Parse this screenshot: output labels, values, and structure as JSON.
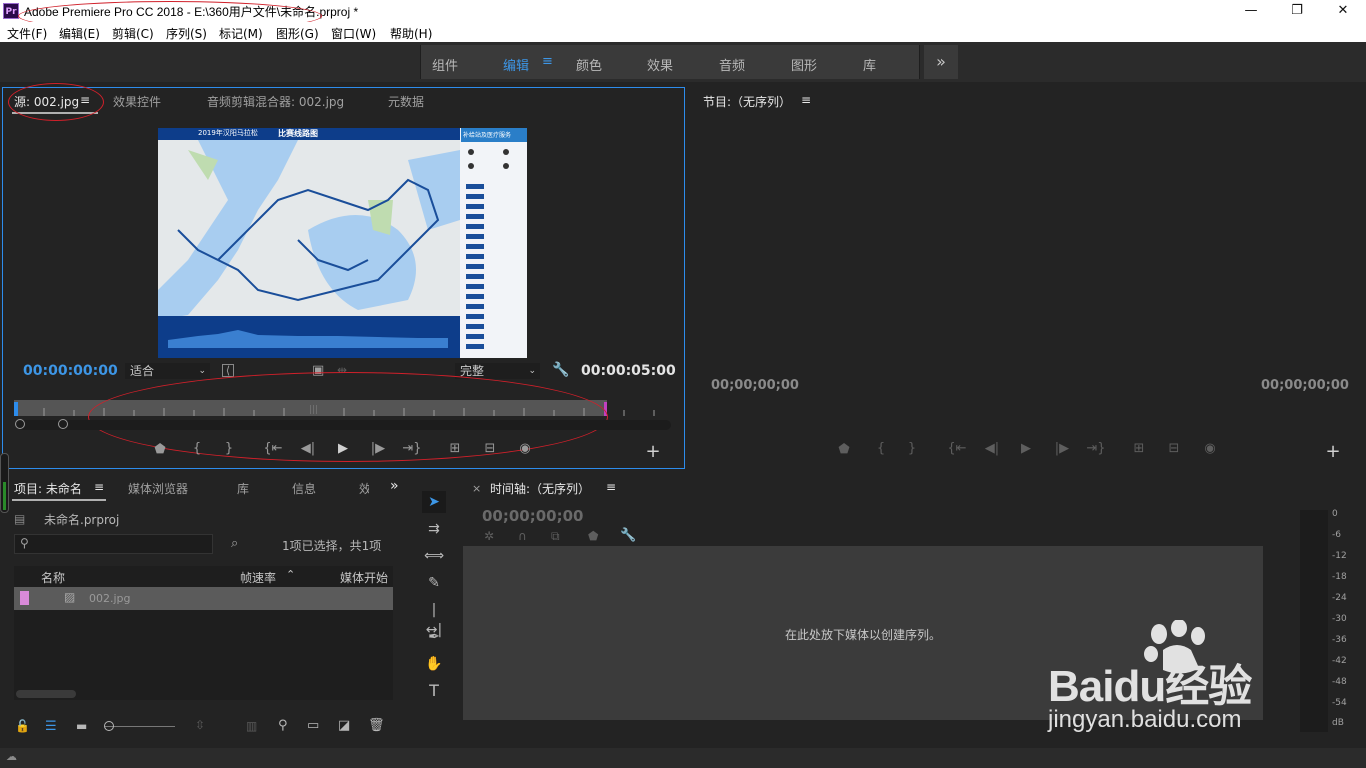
{
  "window": {
    "title": "Adobe Premiere Pro CC 2018 - E:\\360用户文件\\未命名.prproj *",
    "logo_text": "Pr",
    "controls": [
      "—",
      "❐",
      "✕"
    ]
  },
  "menu": [
    "文件(F)",
    "编辑(E)",
    "剪辑(C)",
    "序列(S)",
    "标记(M)",
    "图形(G)",
    "窗口(W)",
    "帮助(H)"
  ],
  "workspaces": {
    "items": [
      "组件",
      "编辑",
      "颜色",
      "效果",
      "音频",
      "图形",
      "库"
    ],
    "active": "编辑",
    "more": "»",
    "menu_icon": "≡"
  },
  "source_panel": {
    "tabs": [
      "源: 002.jpg",
      "效果控件",
      "音频剪辑混合器: 002.jpg",
      "元数据"
    ],
    "active_tab": "源: 002.jpg",
    "timecode_in": "00:00:00:00",
    "timecode_out": "00:00:05:00",
    "zoom_select": "适合",
    "quality_select": "完整",
    "preview": {
      "header_text": "比赛线路图",
      "header_small": "2019年汉阳马拉松",
      "side_header": "补给站及医疗服务"
    }
  },
  "program_panel": {
    "tab": "节目:（无序列）",
    "timecode_left": "00;00;00;00",
    "timecode_right": "00;00;00;00"
  },
  "project_panel": {
    "tabs": [
      "项目: 未命名",
      "媒体浏览器",
      "库",
      "信息",
      "效"
    ],
    "active_tab": "项目: 未命名",
    "project_file": "未命名.prproj",
    "selection_info": "1项已选择，共1项",
    "search_placeholder": "",
    "columns": [
      "名称",
      "帧速率",
      "媒体开始"
    ],
    "items": [
      {
        "name": "002.jpg",
        "label_color": "#d98ad9"
      }
    ]
  },
  "timeline_panel": {
    "tab": "时间轴:（无序列）",
    "timecode": "00;00;00;00",
    "drop_hint": "在此处放下媒体以创建序列。"
  },
  "audio_meter": {
    "ticks": [
      "0",
      "-6",
      "-12",
      "-18",
      "-24",
      "-30",
      "-36",
      "-42",
      "-48",
      "-54",
      "dB"
    ]
  },
  "watermark": {
    "brand": "Baidu经验",
    "url": "jingyan.baidu.com"
  },
  "colors": {
    "accent": "#3d96e6",
    "annotation": "#d0202a",
    "panel_bg": "#232323",
    "dark_bg": "#1e1e1e"
  }
}
